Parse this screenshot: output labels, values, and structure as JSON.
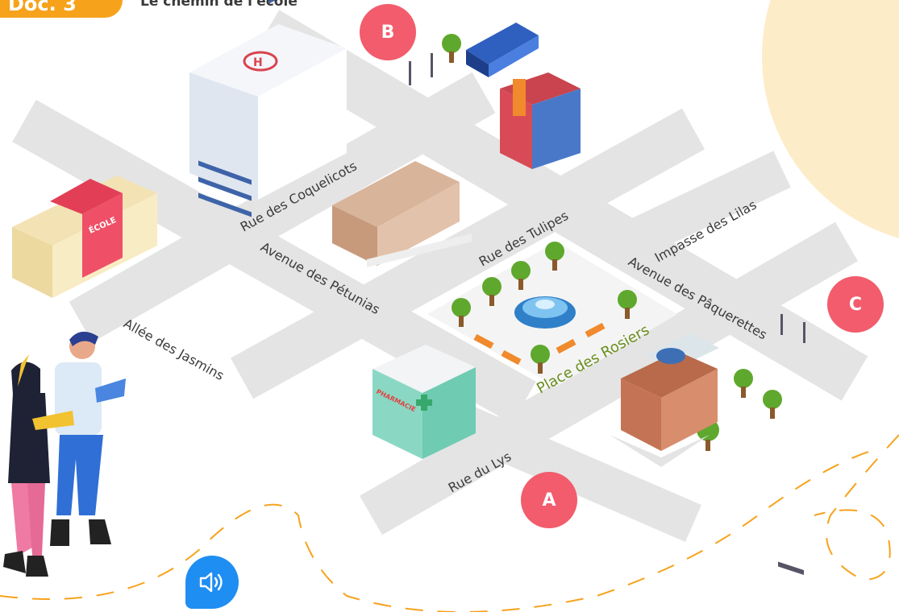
{
  "header": {
    "doc_label": "Doc. 3",
    "title": "Le chemin de l'école"
  },
  "markers": {
    "a": "A",
    "b": "B",
    "c": "C"
  },
  "streets": {
    "coquelicots": "Rue des Coquelicots",
    "petunias": "Avenue des Pétunias",
    "jasmins": "Allée des Jasmins",
    "tulipes": "Rue des Tulipes",
    "lilas": "Impasse des Lilas",
    "paquerettes": "Avenue des Pâquerettes",
    "lys": "Rue du Lys",
    "rosiers": "Place des Rosiers"
  },
  "buildings": {
    "ecole_sign": "ÉCOLE",
    "pharmacie_sign": "PHARMACIE"
  },
  "audio": {
    "icon": "speaker-icon"
  },
  "colors": {
    "road": "#e4e4e4",
    "marker": "#f25c6c",
    "accent": "#f7a21b",
    "audio": "#1f8ef2",
    "place_label": "#6b8e1e"
  }
}
